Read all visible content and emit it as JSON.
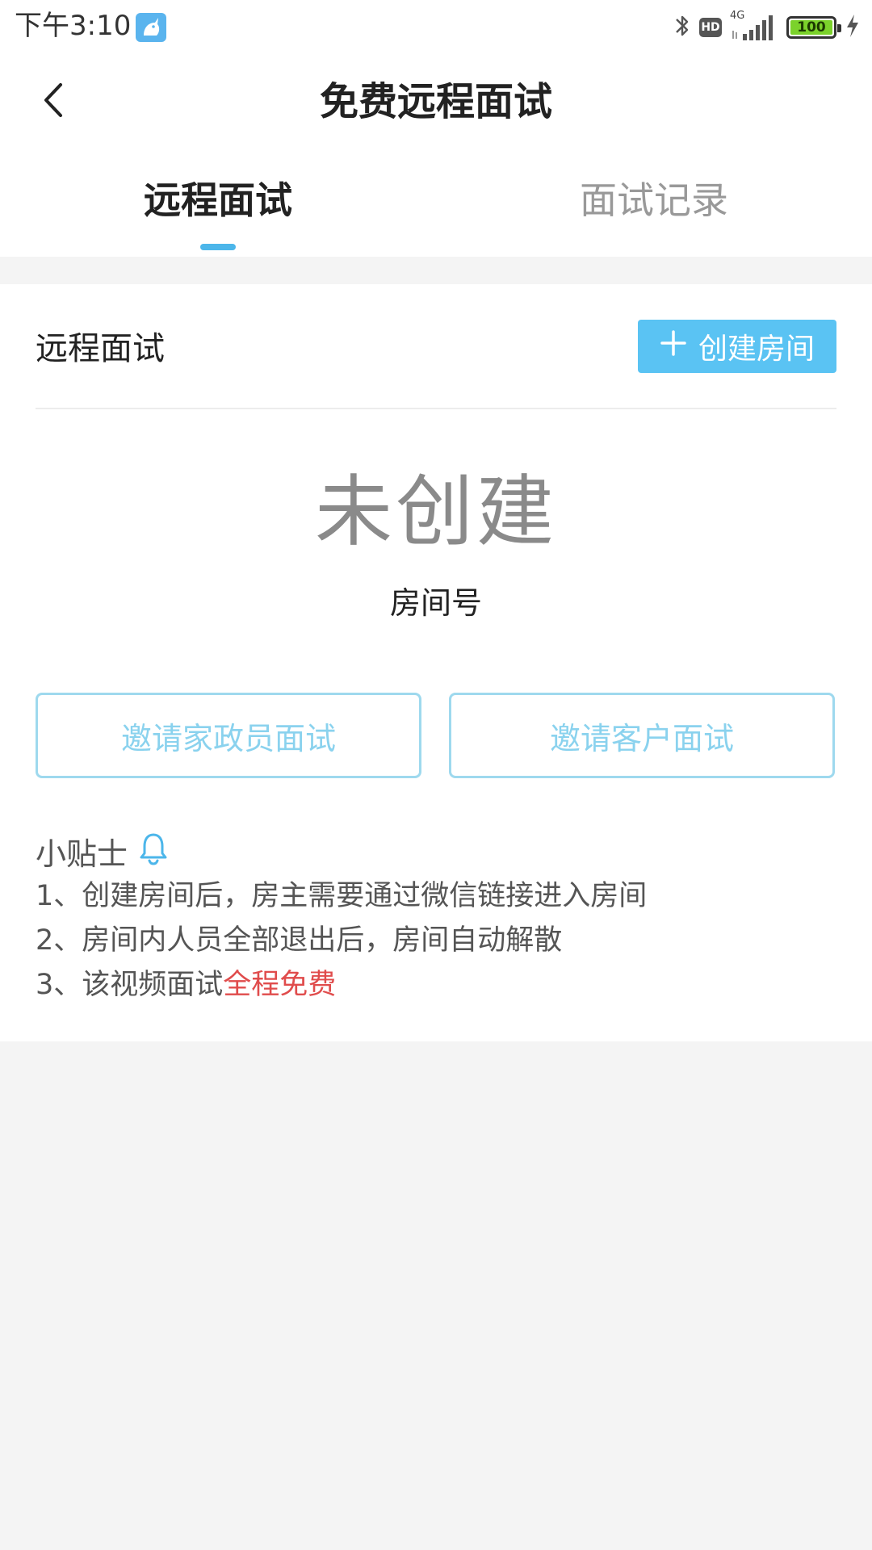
{
  "status_bar": {
    "time": "下午3:10",
    "app_icon": "unicorn-app-icon",
    "hd_label": "HD",
    "network_label": "4G",
    "battery_level": "100",
    "icons": [
      "bluetooth-icon",
      "hd-icon",
      "signal-icon",
      "battery-icon",
      "charging-icon"
    ]
  },
  "header": {
    "back_icon": "chevron-left-icon",
    "title": "免费远程面试"
  },
  "tabs": [
    {
      "label": "远程面试",
      "active": true
    },
    {
      "label": "面试记录",
      "active": false
    }
  ],
  "main": {
    "section_title": "远程面试",
    "create_room_label": "创建房间",
    "create_room_icon": "plus-icon",
    "room_status": "未创建",
    "room_number_label": "房间号",
    "invite_housekeeper_label": "邀请家政员面试",
    "invite_customer_label": "邀请客户面试"
  },
  "tips": {
    "title": "小贴士",
    "icon": "bell-icon",
    "items": [
      "1、创建房间后，房主需要通过微信链接进入房间",
      "2、房间内人员全部退出后，房间自动解散"
    ],
    "item3_prefix": "3、该视频面试",
    "item3_highlight": "全程免费"
  },
  "colors": {
    "accent": "#4cb6ea",
    "button_fill": "#5ac3f3",
    "outline_button": "#9ed9ee",
    "highlight": "#e04c4c",
    "background": "#f4f4f4"
  }
}
